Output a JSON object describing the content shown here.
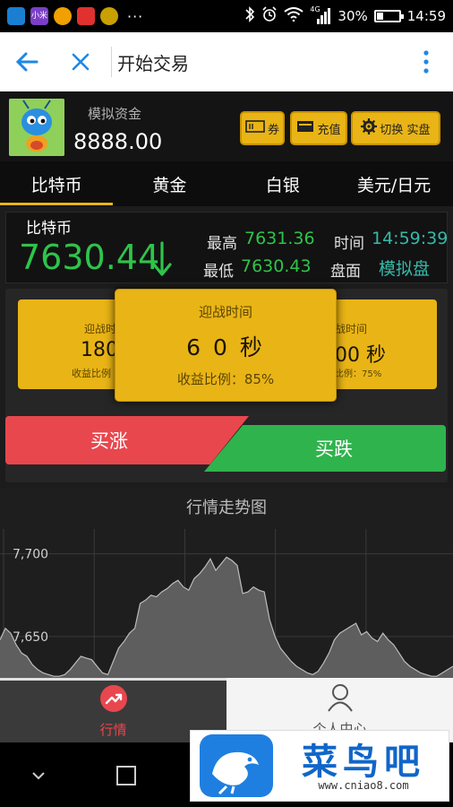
{
  "status_bar": {
    "app_badge": "小米",
    "dots": "···",
    "network": "4G",
    "battery_text": "30%",
    "battery_level": 0.3,
    "time": "14:59"
  },
  "header": {
    "title": "开始交易"
  },
  "account": {
    "label": "模拟资金",
    "balance": "8888.00",
    "coupon_label": "券",
    "recharge_label": "充值",
    "switch_label": "切换 实盘"
  },
  "tabs": [
    {
      "label": "比特币",
      "active": true
    },
    {
      "label": "黄金",
      "active": false
    },
    {
      "label": "白银",
      "active": false
    },
    {
      "label": "美元/日元",
      "active": false
    }
  ],
  "quote": {
    "name": "比特币",
    "price": "7630.44",
    "direction": "down",
    "high_label": "最高",
    "high": "7631.36",
    "low_label": "最低",
    "low": "7630.43",
    "time_label": "时间",
    "time": "14:59:39",
    "mode_label": "盘面",
    "mode": "模拟盘"
  },
  "trade": {
    "cards": [
      {
        "title": "迎战时",
        "time": "180",
        "rate": "收益比例"
      },
      {
        "title": "迎战时间",
        "time": "6 0 秒",
        "rate": "收益比例：85%"
      },
      {
        "title": "战时间",
        "time": "00 秒",
        "rate": "比例：75%"
      }
    ],
    "buy_up_label": "买涨",
    "buy_down_label": "买跌"
  },
  "chart": {
    "title": "行情走势图"
  },
  "chart_data": {
    "type": "area",
    "title": "行情走势图",
    "ytick_labels": [
      "7,700",
      "7,650"
    ],
    "yticks": [
      7700,
      7650
    ],
    "ylim": [
      7625,
      7715
    ],
    "x": [
      0,
      6,
      12,
      18,
      24,
      30,
      36,
      42,
      48,
      54,
      60,
      66,
      72,
      78,
      84,
      90,
      96,
      102,
      108,
      114,
      120,
      126,
      132,
      138,
      144,
      150,
      156,
      162,
      168,
      174,
      180,
      186,
      192,
      198,
      204,
      210,
      216,
      222,
      228,
      234,
      240,
      246,
      252,
      258,
      264,
      270,
      276,
      282,
      288,
      294,
      300,
      306,
      312,
      318,
      324,
      330,
      336,
      342,
      348,
      354,
      360,
      366,
      372,
      378,
      384,
      390,
      396,
      402,
      408,
      414,
      420,
      426,
      432,
      438,
      444,
      450,
      456,
      462,
      468,
      474,
      480,
      486,
      492,
      498,
      504
    ],
    "values": [
      7648,
      7655,
      7652,
      7645,
      7640,
      7638,
      7633,
      7630,
      7628,
      7627,
      7626,
      7626,
      7627,
      7630,
      7634,
      7638,
      7637,
      7636,
      7632,
      7628,
      7627,
      7635,
      7643,
      7647,
      7652,
      7655,
      7670,
      7672,
      7675,
      7674,
      7677,
      7679,
      7682,
      7684,
      7680,
      7678,
      7685,
      7688,
      7692,
      7697,
      7690,
      7694,
      7698,
      7696,
      7693,
      7676,
      7677,
      7680,
      7678,
      7677,
      7660,
      7650,
      7643,
      7639,
      7635,
      7632,
      7630,
      7628,
      7627,
      7629,
      7634,
      7640,
      7648,
      7652,
      7654,
      7656,
      7658,
      7651,
      7653,
      7649,
      7647,
      7652,
      7648,
      7645,
      7640,
      7635,
      7632,
      7630,
      7628,
      7627,
      7626,
      7626,
      7628,
      7630,
      7632
    ],
    "grid": true,
    "colors": {
      "area": "#5e5e5e",
      "line": "#bdbdbd",
      "grid": "#3a3a3a"
    }
  },
  "bottom_nav": {
    "market_label": "行情",
    "mine_label": "个人中心"
  },
  "watermark": {
    "name": "菜鸟吧",
    "url": "www.cniao8.com"
  },
  "colors": {
    "accent_yellow": "#e9b416",
    "price_green": "#2ec44a",
    "buy_up_red": "#e8474e",
    "buy_down_green": "#2fb34c",
    "nav_active": "#e8474e"
  }
}
